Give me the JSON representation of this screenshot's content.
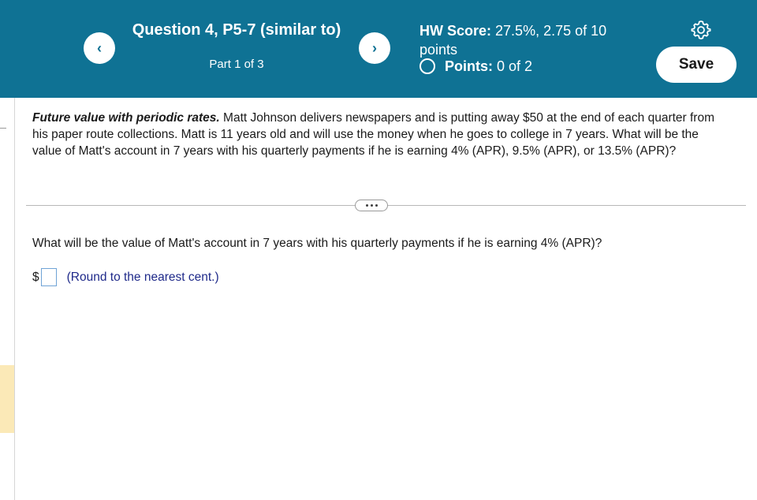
{
  "header": {
    "question_title": "Question 4, P5-7 (similar to)",
    "part": "Part 1 of 3",
    "hw_score_label": "HW Score:",
    "hw_score_value": "27.5%, 2.75 of 10 points",
    "points_label": "Points:",
    "points_value": "0 of 2",
    "save_label": "Save",
    "prev_glyph": "‹",
    "next_glyph": "›"
  },
  "problem": {
    "title": "Future value with periodic rates.",
    "text": "Matt Johnson delivers newspapers and is putting away $50 at the end of each quarter from his paper route collections.  Matt is 11 years old and will use the money when he goes to college in 7 years.  What will be the value of Matt's account in 7 years with his quarterly payments if he is earning 4% (APR), 9.5% (APR), or 13.5% (APR)?"
  },
  "part1": {
    "question": "What will be the value of Matt's account in 7 years with his quarterly payments if he is earning 4% (APR)?",
    "currency": "$",
    "answer_value": "",
    "hint": "(Round to the nearest cent.)"
  },
  "colors": {
    "header_bg": "#0f7294",
    "answer_border": "#6fa3d6",
    "hint_text": "#1f2a8a",
    "left_tab": "#fbe9b7"
  },
  "icons": {
    "settings": "gear-icon",
    "more": "ellipsis-icon"
  }
}
